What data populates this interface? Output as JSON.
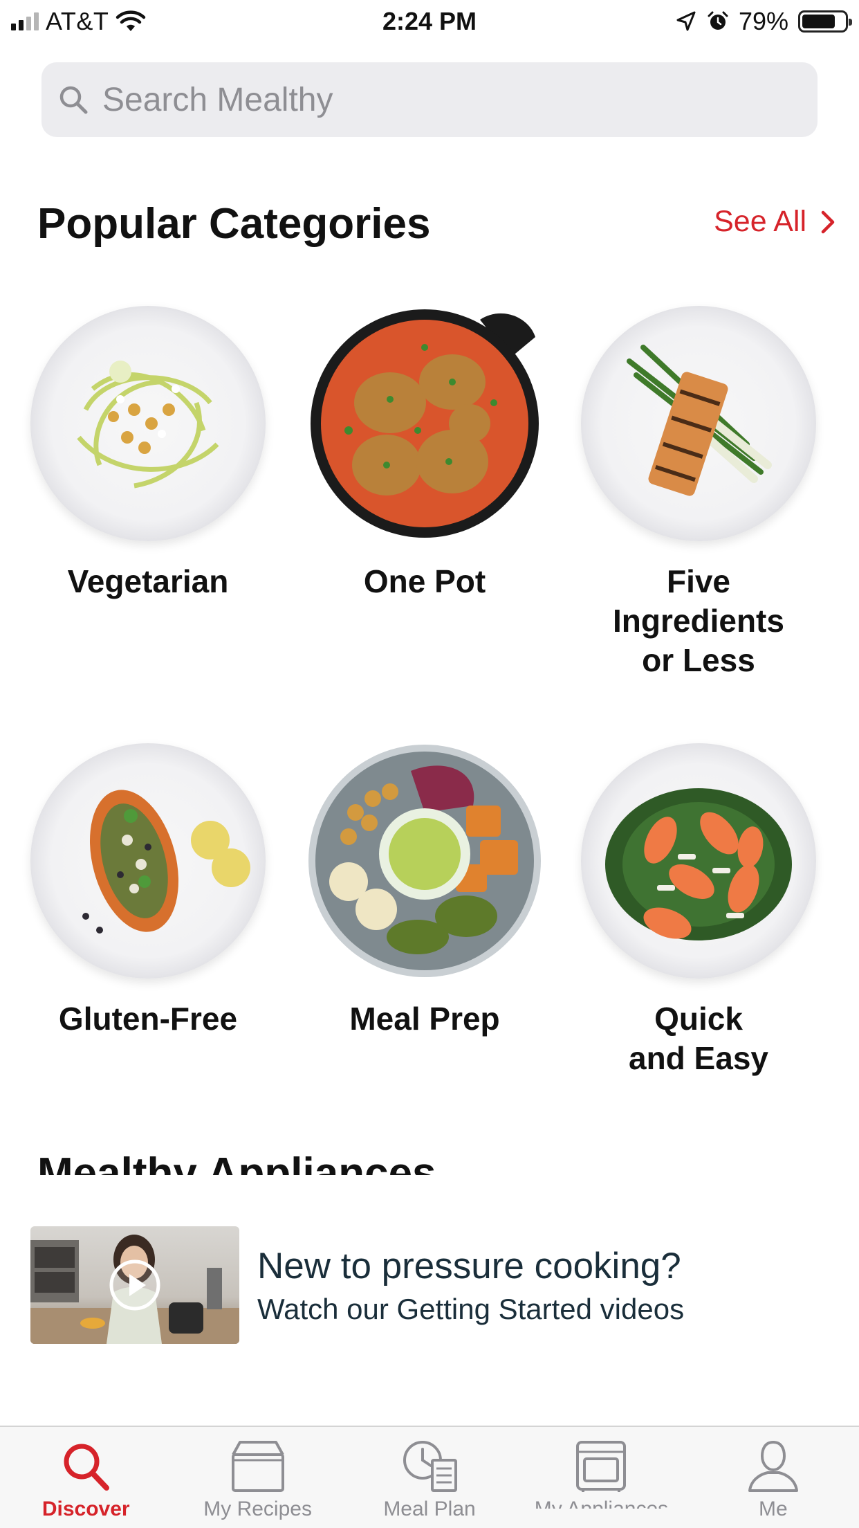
{
  "status_bar": {
    "carrier": "AT&T",
    "time": "2:24 PM",
    "battery_percent": "79%",
    "battery_level": 0.79
  },
  "search": {
    "placeholder": "Search Mealthy"
  },
  "popular": {
    "title": "Popular Categories",
    "see_all": "See All",
    "categories": [
      {
        "label": "Vegetarian",
        "image": "zucchini-noodle-plate"
      },
      {
        "label": "One Pot",
        "image": "chicken-skillet"
      },
      {
        "label": "Five\nIngredients\nor Less",
        "image": "salmon-scallion-plate"
      },
      {
        "label": "Gluten-Free",
        "image": "stuffed-sweet-potato-plate"
      },
      {
        "label": "Meal Prep",
        "image": "meal-prep-bowl"
      },
      {
        "label": "Quick\nand Easy",
        "image": "kale-grapefruit-salad"
      }
    ]
  },
  "appliances": {
    "title": "Mealthy Appliances"
  },
  "video_card": {
    "title": "New to pressure cooking?",
    "subtitle": "Watch our Getting Started videos"
  },
  "tabs": [
    {
      "label": "Discover",
      "icon": "search-icon",
      "active": true
    },
    {
      "label": "My Recipes",
      "icon": "recipe-box-icon",
      "active": false
    },
    {
      "label": "Meal Plan",
      "icon": "meal-plan-icon",
      "active": false
    },
    {
      "label": "My Appliances",
      "icon": "appliance-icon",
      "active": false
    },
    {
      "label": "Me",
      "icon": "profile-icon",
      "active": false
    }
  ],
  "colors": {
    "accent": "#d6232a",
    "inactive_tab": "#8e8e93",
    "search_bg": "#ececef"
  }
}
